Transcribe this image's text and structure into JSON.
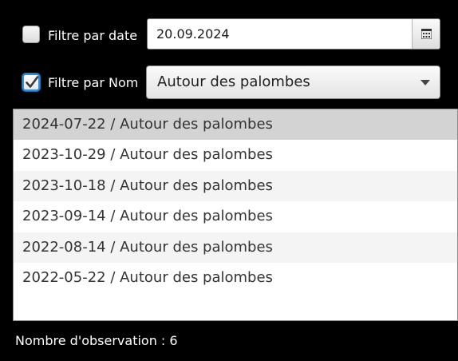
{
  "filters": {
    "date": {
      "label": "Filtre par date",
      "checked": false,
      "value": "20.09.2024",
      "picker_icon": "calendar-icon"
    },
    "name": {
      "label": "Filtre par Nom",
      "checked": true,
      "selected": "Autour des palombes",
      "dropdown_icon": "chevron-down-icon"
    }
  },
  "list": {
    "items": [
      {
        "text": "2024-07-22 / Autour des palombes"
      },
      {
        "text": "2023-10-29 / Autour des palombes"
      },
      {
        "text": "2023-10-18 / Autour des palombes"
      },
      {
        "text": "2023-09-14 / Autour des palombes"
      },
      {
        "text": "2022-08-14 / Autour des palombes"
      },
      {
        "text": "2022-05-22 / Autour des palombes"
      }
    ],
    "selected_index": 0
  },
  "status": {
    "text": "Nombre d'observation : 6"
  }
}
